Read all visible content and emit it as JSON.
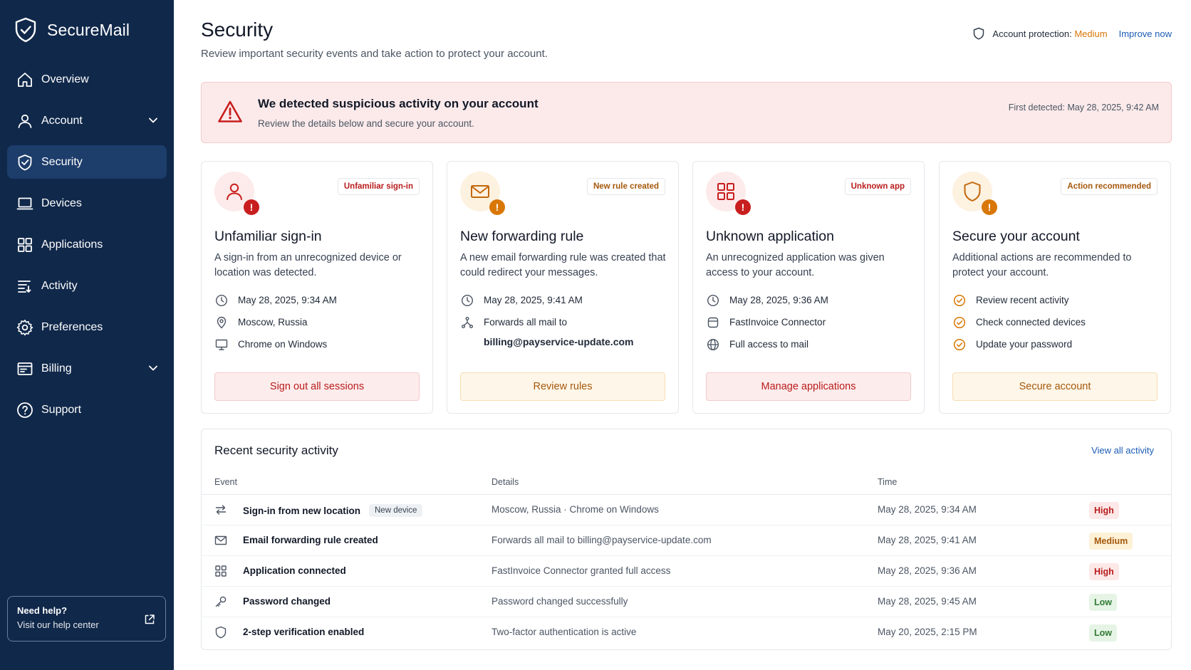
{
  "brand": {
    "name": "SecureMail",
    "icon": "shield-check-icon"
  },
  "sidebar": {
    "items": [
      {
        "label": "Overview",
        "icon": "home-icon",
        "active": false,
        "chevron": false
      },
      {
        "label": "Account",
        "icon": "user-icon",
        "active": false,
        "chevron": true
      },
      {
        "label": "Security",
        "icon": "shield-check-icon",
        "active": true,
        "chevron": false
      },
      {
        "label": "Devices",
        "icon": "laptop-icon",
        "active": false,
        "chevron": false
      },
      {
        "label": "Applications",
        "icon": "grid-icon",
        "active": false,
        "chevron": false
      },
      {
        "label": "Activity",
        "icon": "activity-list-icon",
        "active": false,
        "chevron": false
      },
      {
        "label": "Preferences",
        "icon": "gear-icon",
        "active": false,
        "chevron": false
      },
      {
        "label": "Billing",
        "icon": "billing-icon",
        "active": false,
        "chevron": true
      },
      {
        "label": "Support",
        "icon": "help-circle-icon",
        "active": false,
        "chevron": false
      }
    ],
    "help": {
      "title": "Need help?",
      "subtitle": "Visit our help center"
    }
  },
  "header": {
    "title": "Security",
    "subtitle": "Review important security events and take action to protect your account.",
    "protection_label": "Account protection:",
    "protection_level": "Medium",
    "improve_label": "Improve now"
  },
  "alert": {
    "title": "We detected suspicious activity on your account",
    "subtitle": "Review the details below and secure your account.",
    "first_detected": "First detected: May 28, 2025, 9:42 AM"
  },
  "cards": [
    {
      "badge": "Unfamiliar sign-in",
      "title": "Unfamiliar sign-in",
      "desc": "A sign-in from an unrecognized device or location was detected.",
      "rows": [
        {
          "icon": "clock-icon",
          "text": "May 28, 2025, 9:34 AM"
        },
        {
          "icon": "location-pin-icon",
          "text": "Moscow, Russia"
        },
        {
          "icon": "monitor-icon",
          "text": "Chrome on Windows"
        }
      ],
      "button": "Sign out all sessions"
    },
    {
      "badge": "New rule created",
      "title": "New forwarding rule",
      "desc": "A new email forwarding rule was created that could redirect your messages.",
      "rows": [
        {
          "icon": "clock-icon",
          "text": "May 28, 2025, 9:41 AM"
        },
        {
          "icon": "forward-branch-icon",
          "text": "Forwards all mail to",
          "text2": "billing@payservice-update.com"
        }
      ],
      "button": "Review rules"
    },
    {
      "badge": "Unknown app",
      "title": "Unknown application",
      "desc": "An unrecognized application was given access to your account.",
      "rows": [
        {
          "icon": "clock-icon",
          "text": "May 28, 2025, 9:36 AM"
        },
        {
          "icon": "app-icon",
          "text": "FastInvoice Connector"
        },
        {
          "icon": "globe-icon",
          "text": "Full access to mail"
        }
      ],
      "button": "Manage applications"
    },
    {
      "badge": "Action recommended",
      "title": "Secure your account",
      "desc": "Additional actions are recommended to protect your account.",
      "rows": [
        {
          "icon": "check-circle-icon",
          "text": "Review recent activity"
        },
        {
          "icon": "check-circle-icon",
          "text": "Check connected devices"
        },
        {
          "icon": "check-circle-icon",
          "text": "Update your password"
        }
      ],
      "button": "Secure account"
    }
  ],
  "activity": {
    "title": "Recent security activity",
    "view_all": "View all activity",
    "columns": [
      "Event",
      "Details",
      "Time"
    ],
    "rows": [
      {
        "icon": "swap-arrows-icon",
        "event": "Sign-in from new location",
        "tag": "New device",
        "details": "Moscow, Russia · Chrome on Windows",
        "time": "May 28, 2025, 9:34 AM",
        "severity": "High"
      },
      {
        "icon": "mail-icon",
        "event": "Email forwarding rule created",
        "tag": "",
        "details": "Forwards all mail to billing@payservice-update.com",
        "time": "May 28, 2025, 9:41 AM",
        "severity": "Medium"
      },
      {
        "icon": "grid-icon",
        "event": "Application connected",
        "tag": "",
        "details": "FastInvoice Connector granted full access",
        "time": "May 28, 2025, 9:36 AM",
        "severity": "High"
      },
      {
        "icon": "key-icon",
        "event": "Password changed",
        "tag": "",
        "details": "Password changed successfully",
        "time": "May 28, 2025, 9:45 AM",
        "severity": "Low"
      },
      {
        "icon": "shield-icon",
        "event": "2-step verification enabled",
        "tag": "",
        "details": "Two-factor authentication is active",
        "time": "May 20, 2025, 2:15 PM",
        "severity": "Low"
      }
    ]
  },
  "colors": {
    "sidebar_bg": "#10284a",
    "sidebar_active": "#1d3d6b",
    "danger": "#c81e1e",
    "warning": "#d97706",
    "link": "#1d5cb5",
    "alert_bg": "#fceaea"
  }
}
